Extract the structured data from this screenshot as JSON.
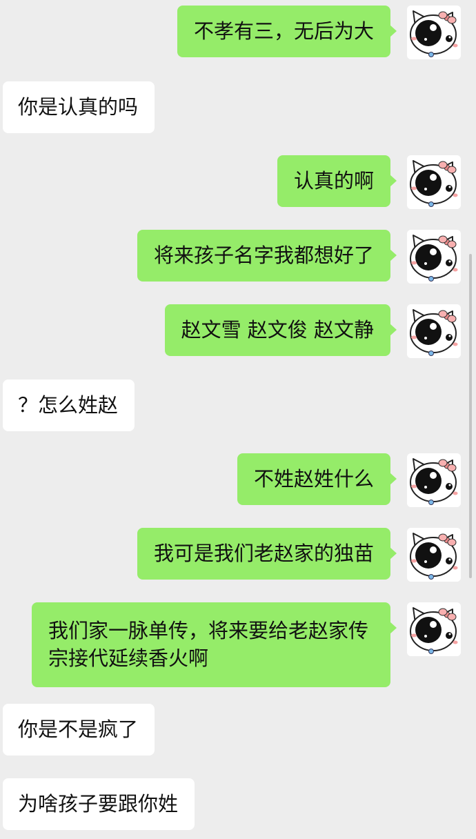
{
  "chat": {
    "messages": [
      {
        "side": "self",
        "text": "不孝有三，无后为大",
        "avatar": "hello-kitty-avatar"
      },
      {
        "side": "other",
        "text": "你是认真的吗"
      },
      {
        "side": "self",
        "text": "认真的啊",
        "avatar": "hello-kitty-avatar"
      },
      {
        "side": "self",
        "text": "将来孩子名字我都想好了",
        "avatar": "hello-kitty-avatar"
      },
      {
        "side": "self",
        "text": "赵文雪 赵文俊 赵文静",
        "avatar": "hello-kitty-avatar"
      },
      {
        "side": "other",
        "text": "？怎么姓赵"
      },
      {
        "side": "self",
        "text": "不姓赵姓什么",
        "avatar": "hello-kitty-avatar"
      },
      {
        "side": "self",
        "text": "我可是我们老赵家的独苗",
        "avatar": "hello-kitty-avatar"
      },
      {
        "side": "self",
        "text": "我们家一脉单传，将来要给老赵家传宗接代延续香火啊",
        "avatar": "hello-kitty-avatar"
      },
      {
        "side": "other",
        "text": "你是不是疯了"
      },
      {
        "side": "other",
        "text": "为啥孩子要跟你姓"
      }
    ]
  },
  "colors": {
    "background": "#ededed",
    "self_bubble": "#95ec69",
    "other_bubble": "#ffffff",
    "text": "#111111",
    "avatar_bow": "#f08a8a",
    "avatar_eye": "#111111"
  }
}
